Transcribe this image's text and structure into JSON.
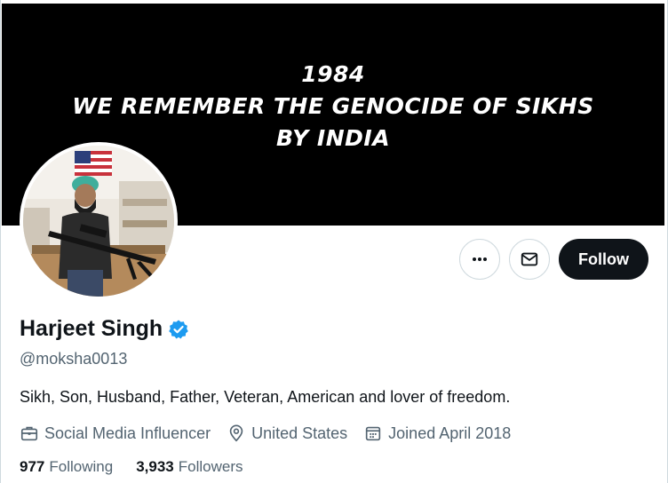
{
  "banner": {
    "lines": [
      "1984",
      "WE REMEMBER THE GENOCIDE OF SIKHS",
      "BY INDIA"
    ]
  },
  "profile": {
    "name": "Harjeet Singh",
    "handle": "@moksha0013",
    "bio": "Sikh, Son, Husband, Father, Veteran, American and lover of freedom.",
    "category": "Social Media Influencer",
    "location": "United States",
    "joined": "Joined April 2018",
    "verified": true
  },
  "stats": {
    "following_count": "977",
    "following_label": "Following",
    "followers_count": "3,933",
    "followers_label": "Followers"
  },
  "actions": {
    "follow_label": "Follow",
    "more_icon": "more-icon",
    "message_icon": "envelope-icon"
  },
  "colors": {
    "primary_text": "#0f1419",
    "secondary_text": "#536471",
    "verified_blue": "#1d9bf0",
    "border": "#cfd9de"
  }
}
